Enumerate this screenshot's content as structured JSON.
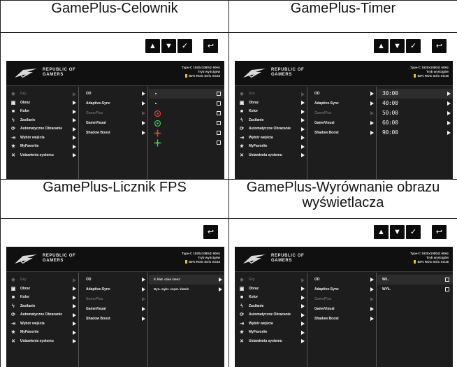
{
  "panels": [
    {
      "id": "celownik",
      "title": "GamePlus-Celownik",
      "show_arrows": true,
      "column2": [
        {
          "label": "OD",
          "dim": false
        },
        {
          "label": "Adaptive-Sync",
          "dim": false
        },
        {
          "label": "GamePlus",
          "dim": true
        },
        {
          "label": "GameVisual",
          "dim": false
        },
        {
          "label": "Shadow Boost",
          "dim": false
        }
      ]
    },
    {
      "id": "timer",
      "title": "GamePlus-Timer",
      "show_arrows": true,
      "column2": [
        {
          "label": "OD",
          "dim": false
        },
        {
          "label": "Adaptive-Sync",
          "dim": false
        },
        {
          "label": "GamePlus",
          "dim": true
        },
        {
          "label": "GameVisual",
          "dim": false
        },
        {
          "label": "Shadow Boost",
          "dim": false
        }
      ],
      "timers": [
        "30:00",
        "40:00",
        "50:00",
        "60:00",
        "90:00"
      ]
    },
    {
      "id": "fps",
      "title": "GamePlus-Licznik FPS",
      "show_arrows": false,
      "column2": [
        {
          "label": "OD",
          "dim": false
        },
        {
          "label": "Adaptive-Sync",
          "dim": false
        },
        {
          "label": "GamePlus",
          "dim": true
        },
        {
          "label": "GameVisual",
          "dim": false
        },
        {
          "label": "Shadow Boost",
          "dim": false
        }
      ],
      "options": [
        "Il. klat. czas rzecz",
        "Dyn. wykr. częst. klatek"
      ]
    },
    {
      "id": "align",
      "title_part1": "GamePlus",
      "title_part2": "-Wyrównanie obrazu",
      "title_line2": "wyświetlacza",
      "show_arrows": true,
      "column2": [
        {
          "label": "OD",
          "dim": false
        },
        {
          "label": "Adaptive-Sync",
          "dim": false
        },
        {
          "label": "GamePlus",
          "dim": true
        },
        {
          "label": "GameVisual",
          "dim": false
        },
        {
          "label": "Shadow Boost",
          "dim": false
        }
      ],
      "options": [
        "WŁ.",
        "WYŁ."
      ]
    }
  ],
  "buttons": {
    "up": "▲",
    "down": "▼",
    "ok": "✓",
    "back": "↩"
  },
  "brand": {
    "line1": "REPUBLIC OF",
    "line2": "GAMERS"
  },
  "info": {
    "line1": "Type-C  1920x1080@  60Hz",
    "line2": "Tryb wyścigów",
    "line3": "82%  ROG Strix XG16"
  },
  "main_menu": [
    {
      "label": "Gry",
      "icon": "game-icon",
      "glyph": "◆",
      "dim": true
    },
    {
      "label": "Obraz",
      "icon": "image-icon",
      "glyph": "▣",
      "dim": false
    },
    {
      "label": "Kolor",
      "icon": "color-icon",
      "glyph": "■",
      "dim": false
    },
    {
      "label": "Zasilanie",
      "icon": "power-icon",
      "glyph": "ϟ",
      "dim": false
    },
    {
      "label": "Automatyczne Obracanie",
      "icon": "rotate-icon",
      "glyph": "⟳",
      "dim": false
    },
    {
      "label": "Wybór wejścia",
      "icon": "input-icon",
      "glyph": "⇥",
      "dim": false
    },
    {
      "label": "MyFavorite",
      "icon": "star-icon",
      "glyph": "★",
      "dim": false
    },
    {
      "label": "Ustawienia systemu",
      "icon": "settings-icon",
      "glyph": "✕",
      "dim": false
    }
  ],
  "colors": {
    "crosshair_red": "#e0463c",
    "crosshair_green": "#4cc94c",
    "battery": "#f3c000"
  }
}
